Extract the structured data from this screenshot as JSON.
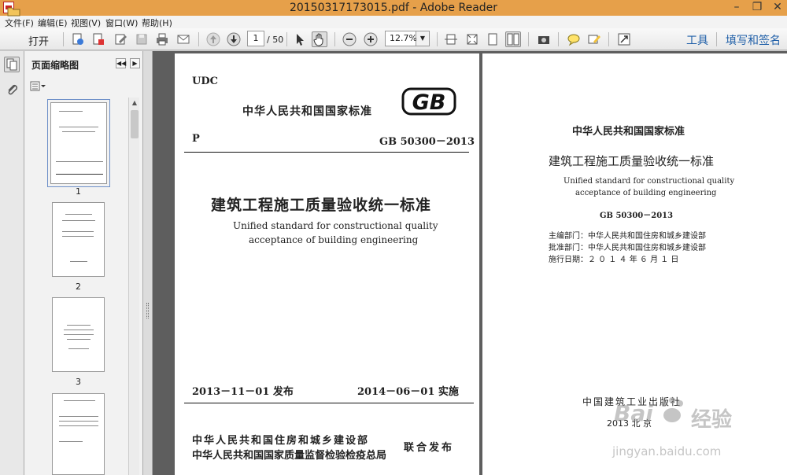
{
  "window": {
    "title": "20150317173015.pdf - Adobe Reader",
    "minimize_glyph": "–",
    "maximize_glyph": "❐",
    "close_glyph": "✕"
  },
  "menu": [
    "文件(F)",
    "编辑(E)",
    "视图(V)",
    "窗口(W)",
    "帮助(H)"
  ],
  "toolbar": {
    "open_label": "打开",
    "page_current": "1",
    "page_total": "/ 50",
    "zoom": "12.7%",
    "tools_label": "工具",
    "fill_sign_label": "填写和签名"
  },
  "sidebar": {
    "title": "页面缩略图",
    "collapse_glyph": "◀◀",
    "next_glyph": "▶",
    "thumbnails": [
      "1",
      "2",
      "3"
    ]
  },
  "page1": {
    "udc": "UDC",
    "national_standard": "中华人民共和国国家标准",
    "logo_text": "GB",
    "category": "P",
    "code": "GB 50300－2013",
    "title_cn": "建筑工程施工质量验收统一标准",
    "title_en_1": "Unified standard for constructional quality",
    "title_en_2": "acceptance of building engineering",
    "issue_date": "2013－11－01  发布",
    "effective_date": "2014－06－01  实施",
    "issuer_1": "中华人民共和国住房和城乡建设部",
    "issuer_2": "中华人民共和国国家质量监督检验检疫总局",
    "joint_release": "联合发布"
  },
  "page2": {
    "national_standard": "中华人民共和国国家标准",
    "title_cn": "建筑工程施工质量验收统一标准",
    "title_en_1": "Unified standard for constructional quality",
    "title_en_2": "acceptance of building engineering",
    "code": "GB 50300－2013",
    "editor": "主编部门：中华人民共和国住房和城乡建设部",
    "approver": "批准部门：中华人民共和国住房和城乡建设部",
    "effective": "施行日期：２ ０ １ ４ 年 ６ 月 １ 日",
    "publisher": "中国建筑工业出版社",
    "city": "2013   北   京"
  },
  "watermark": {
    "brand": "Bai",
    "brand_cn": "经验",
    "url": "jingyan.baidu.com"
  },
  "colors": {
    "titlebar": "#e6a04a",
    "link": "#1f5fa8",
    "document_background": "#5e5e5e"
  }
}
